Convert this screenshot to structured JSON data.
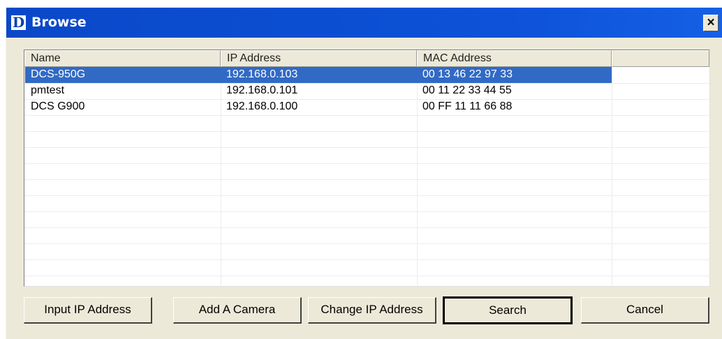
{
  "window": {
    "title": "Browse",
    "close_label": "×",
    "app_icon": "D"
  },
  "list": {
    "columns": [
      "Name",
      "IP Address",
      "MAC Address",
      ""
    ],
    "rows": [
      {
        "name": "DCS-950G",
        "ip": "192.168.0.103",
        "mac": "00 13 46 22 97 33",
        "selected": true
      },
      {
        "name": "pmtest",
        "ip": "192.168.0.101",
        "mac": "00 11 22 33 44 55",
        "selected": false
      },
      {
        "name": "DCS G900",
        "ip": "192.168.0.100",
        "mac": "00 FF 11 11 66 88",
        "selected": false
      }
    ]
  },
  "buttons": {
    "input_ip": "Input IP Address",
    "add_camera": "Add A Camera",
    "change_ip": "Change IP Address",
    "search": "Search",
    "cancel": "Cancel"
  },
  "colors": {
    "titlebar": "#0a4bd0",
    "selection": "#316ac5",
    "dialog_bg": "#ece9d8"
  }
}
